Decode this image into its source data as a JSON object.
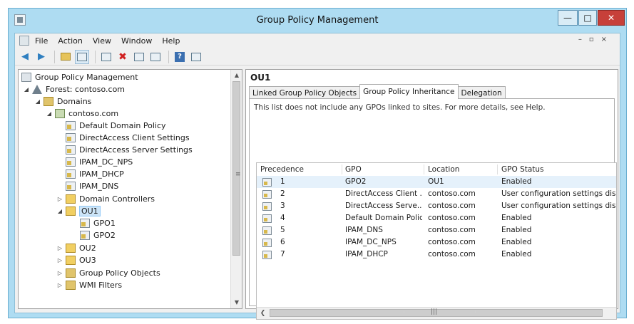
{
  "window": {
    "title": "Group Policy Management"
  },
  "menubar": {
    "items": [
      "File",
      "Action",
      "View",
      "Window",
      "Help"
    ]
  },
  "toolbar": {
    "buttons": [
      "back-arrow-icon",
      "forward-arrow-icon",
      "up-folder-icon",
      "show-hide-tree-icon",
      "properties-icon",
      "delete-icon",
      "export-list-icon",
      "refresh-icon",
      "help-icon",
      "show-action-pane-icon"
    ]
  },
  "tree": {
    "root": "Group Policy Management",
    "forest": "Forest: contoso.com",
    "domains": "Domains",
    "domain": "contoso.com",
    "linked_gpos": [
      "Default Domain Policy",
      "DirectAccess Client Settings",
      "DirectAccess Server Settings",
      "IPAM_DC_NPS",
      "IPAM_DHCP",
      "IPAM_DNS"
    ],
    "domain_controllers": "Domain Controllers",
    "ou1": "OU1",
    "ou1_gpos": [
      "GPO1",
      "GPO2"
    ],
    "ou2": "OU2",
    "ou3": "OU3",
    "gpo_container": "Group Policy Objects",
    "wmi_filters": "WMI Filters"
  },
  "details": {
    "title": "OU1",
    "tabs": [
      "Linked Group Policy Objects",
      "Group Policy Inheritance",
      "Delegation"
    ],
    "active_tab": "Group Policy Inheritance",
    "note": "This list does not include any GPOs linked to sites. For more details, see Help.",
    "columns": [
      "Precedence",
      "GPO",
      "Location",
      "GPO Status"
    ],
    "rows": [
      {
        "precedence": "1",
        "gpo": "GPO2",
        "location": "OU1",
        "status": "Enabled"
      },
      {
        "precedence": "2",
        "gpo": "DirectAccess Client ...",
        "location": "contoso.com",
        "status": "User configuration settings disabled"
      },
      {
        "precedence": "3",
        "gpo": "DirectAccess Serve...",
        "location": "contoso.com",
        "status": "User configuration settings disabled"
      },
      {
        "precedence": "4",
        "gpo": "Default Domain Policy",
        "location": "contoso.com",
        "status": "Enabled"
      },
      {
        "precedence": "5",
        "gpo": "IPAM_DNS",
        "location": "contoso.com",
        "status": "Enabled"
      },
      {
        "precedence": "6",
        "gpo": "IPAM_DC_NPS",
        "location": "contoso.com",
        "status": "Enabled"
      },
      {
        "precedence": "7",
        "gpo": "IPAM_DHCP",
        "location": "contoso.com",
        "status": "Enabled"
      }
    ]
  }
}
